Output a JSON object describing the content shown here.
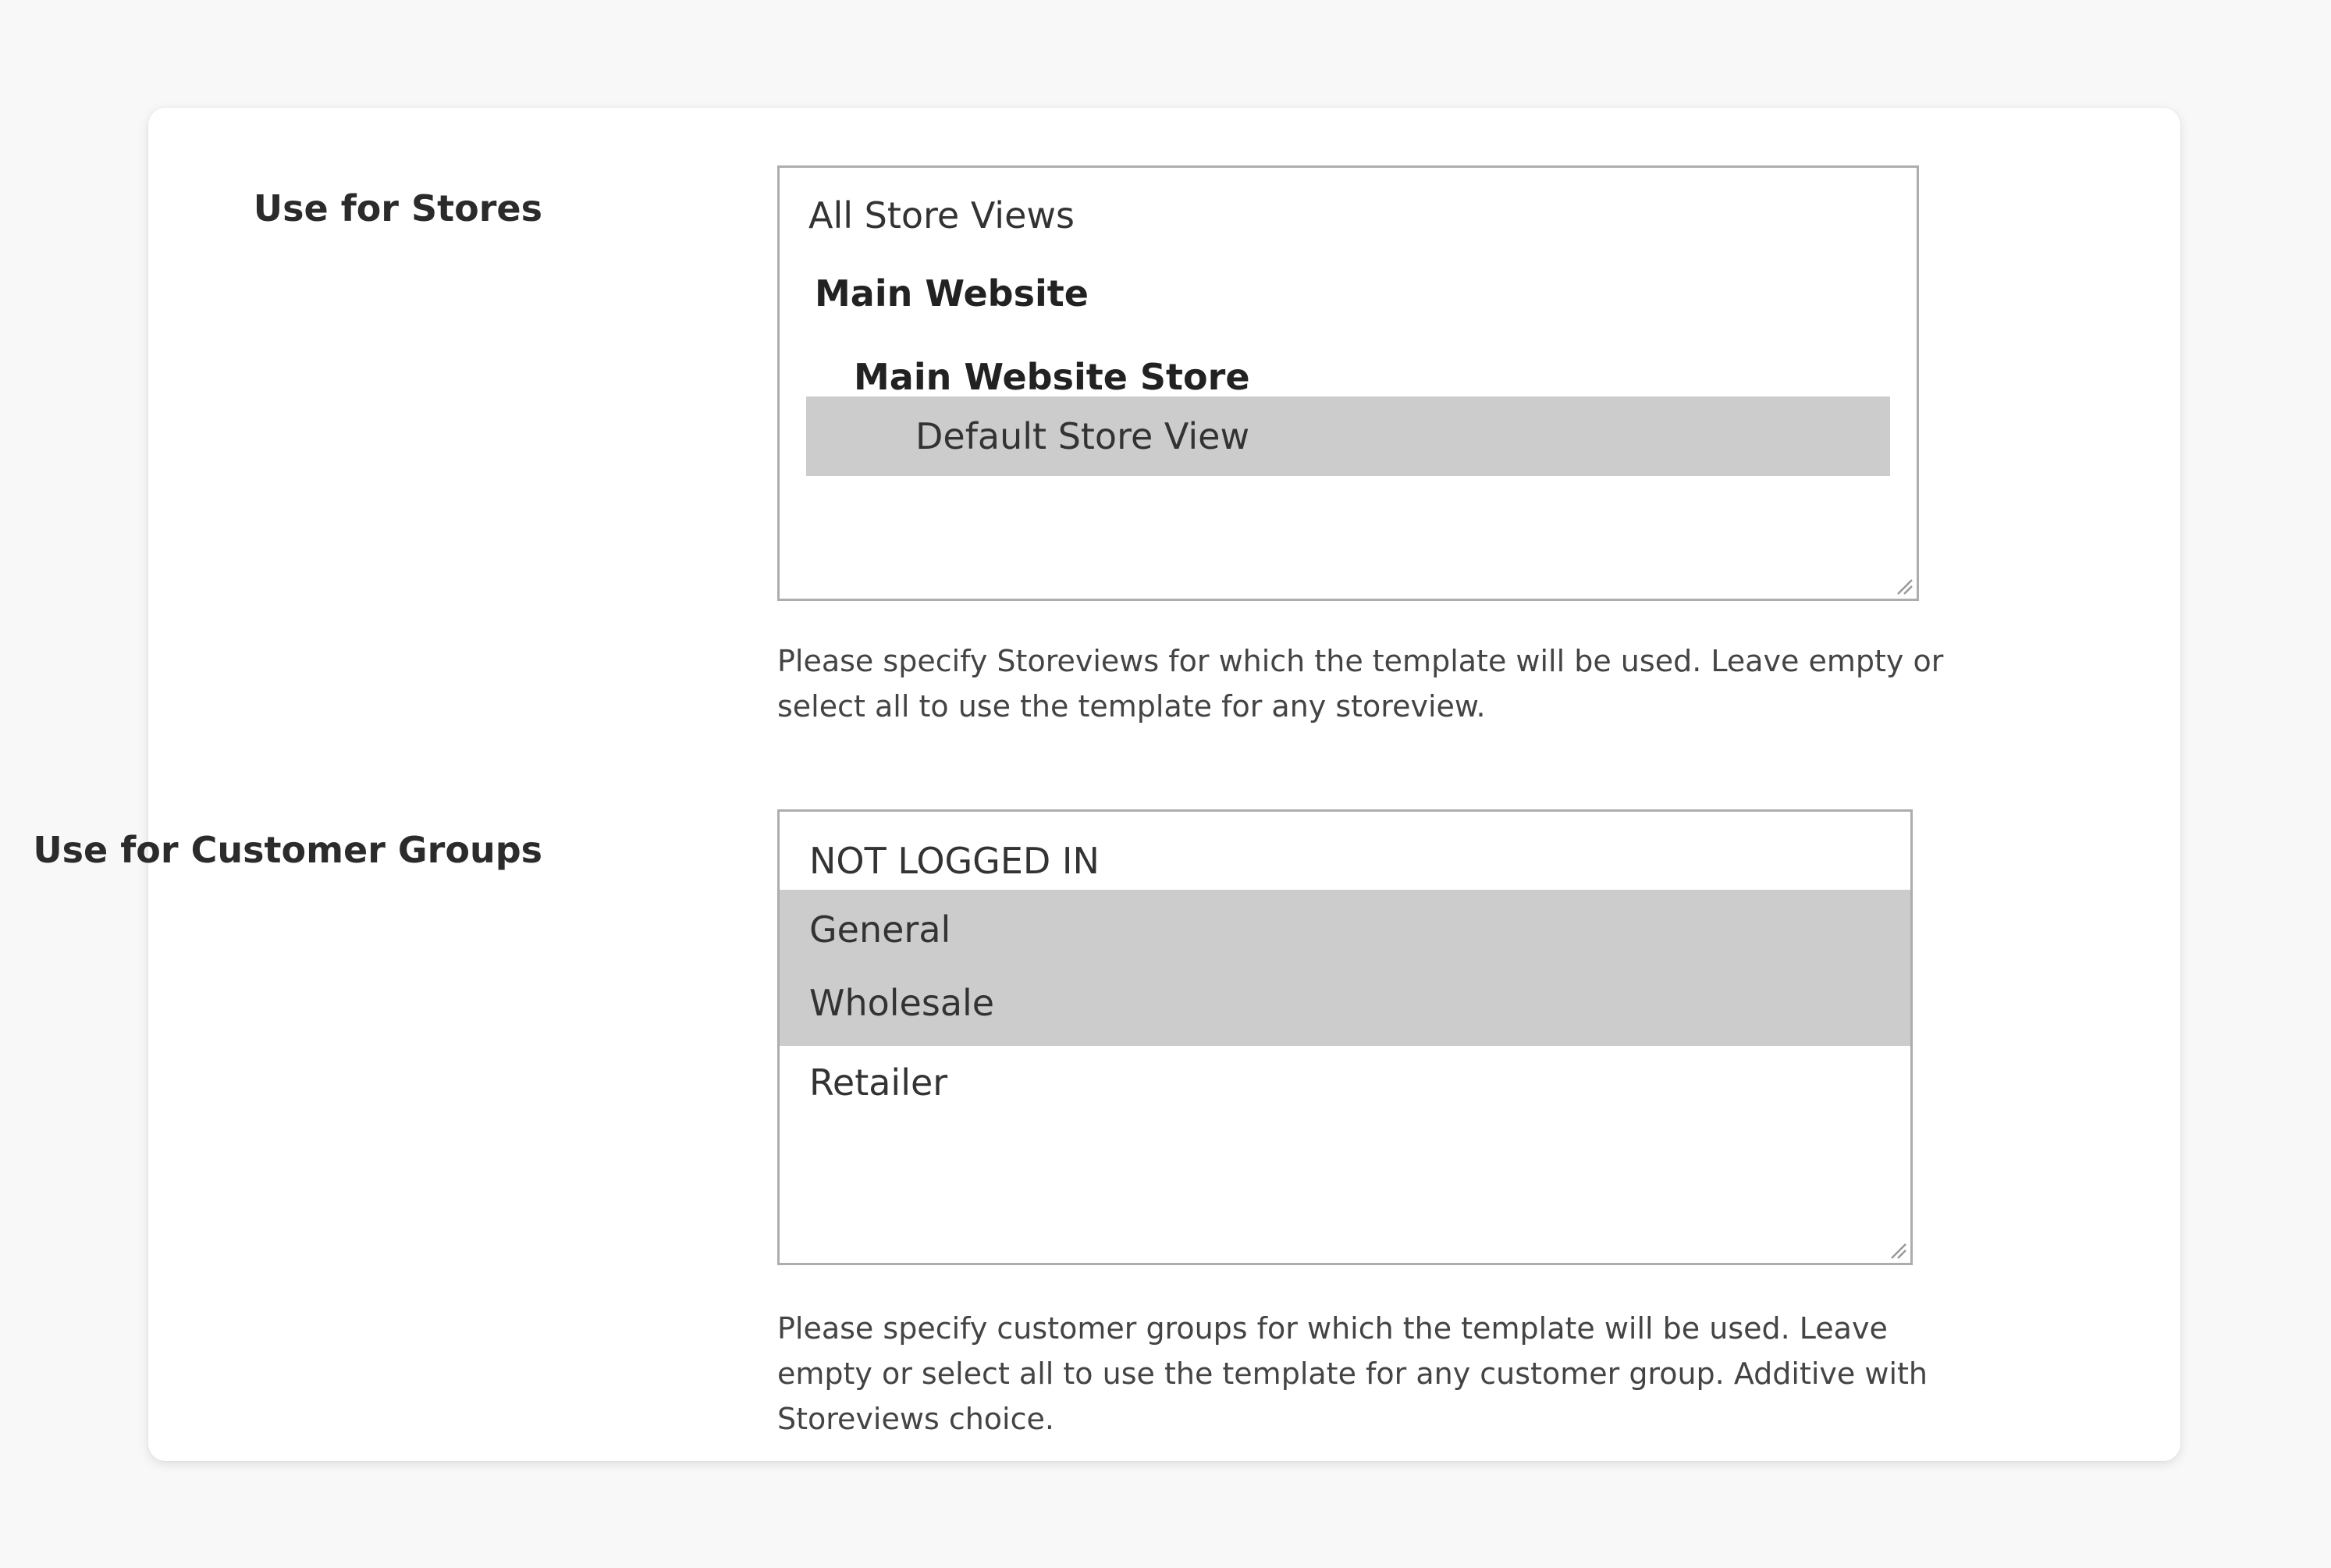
{
  "stores": {
    "label": "Use for Stores",
    "options": {
      "all": "All Store Views",
      "website": "Main Website",
      "store": "Main Website Store",
      "default_view": "Default Store View"
    },
    "selected": "Default Store View",
    "note": "Please specify Storeviews for which the template will be used. Leave empty or select all to use the template for any storeview."
  },
  "customer_groups": {
    "label": "Use for Customer Groups",
    "options": {
      "not_logged_in": "NOT LOGGED IN",
      "general": "General",
      "wholesale": "Wholesale",
      "retailer": "Retailer"
    },
    "selected": [
      "General",
      "Wholesale"
    ],
    "note": "Please specify customer groups for which the template will be used. Leave empty or select all to use the template for any customer group. Additive with Storeviews choice."
  },
  "colors": {
    "selected_option": "#cccccc",
    "border": "#adadad",
    "page_background": "#f8f8f8"
  },
  "icons": {
    "resize": "resize-grip-icon"
  }
}
